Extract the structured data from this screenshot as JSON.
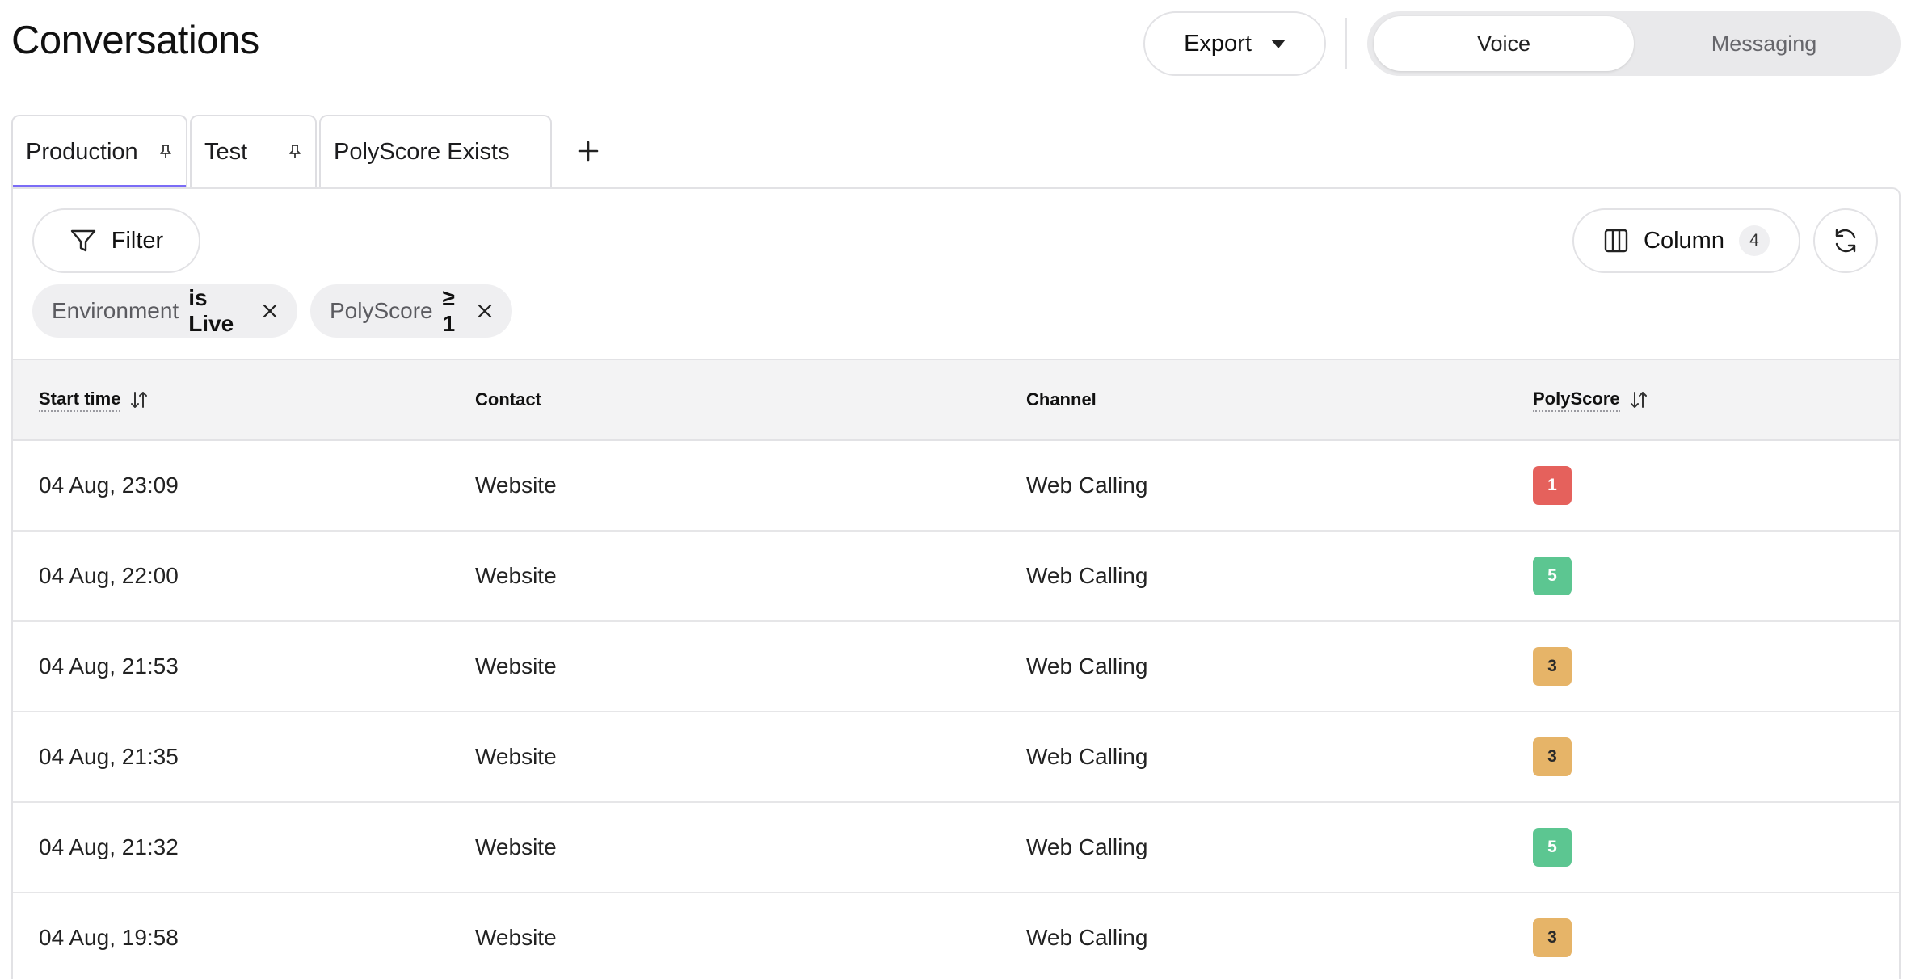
{
  "page": {
    "title": "Conversations"
  },
  "header": {
    "export_label": "Export",
    "segment": [
      {
        "label": "Voice",
        "active": true
      },
      {
        "label": "Messaging",
        "active": false
      }
    ]
  },
  "tabs": [
    {
      "label": "Production",
      "pinned": true,
      "active": true
    },
    {
      "label": "Test",
      "pinned": true,
      "active": false
    },
    {
      "label": "PolyScore Exists",
      "pinned": false,
      "active": false
    }
  ],
  "toolbar": {
    "filter_label": "Filter",
    "column_label": "Column",
    "column_count": "4"
  },
  "filters": [
    {
      "field": "Environment",
      "op": "is Live"
    },
    {
      "field": "PolyScore",
      "op": "≥ 1"
    }
  ],
  "table": {
    "columns": [
      "Start time",
      "Contact",
      "Channel",
      "PolyScore"
    ],
    "rows": [
      {
        "start": "04 Aug, 23:09",
        "contact": "Website",
        "channel": "Web Calling",
        "score": "1"
      },
      {
        "start": "04 Aug, 22:00",
        "contact": "Website",
        "channel": "Web Calling",
        "score": "5"
      },
      {
        "start": "04 Aug, 21:53",
        "contact": "Website",
        "channel": "Web Calling",
        "score": "3"
      },
      {
        "start": "04 Aug, 21:35",
        "contact": "Website",
        "channel": "Web Calling",
        "score": "3"
      },
      {
        "start": "04 Aug, 21:32",
        "contact": "Website",
        "channel": "Web Calling",
        "score": "5"
      },
      {
        "start": "04 Aug, 19:58",
        "contact": "Website",
        "channel": "Web Calling",
        "score": "3"
      }
    ]
  },
  "colors": {
    "accent": "#7b6cf6",
    "score_1": "#e5615c",
    "score_3": "#e6b468",
    "score_5": "#5cc691"
  }
}
